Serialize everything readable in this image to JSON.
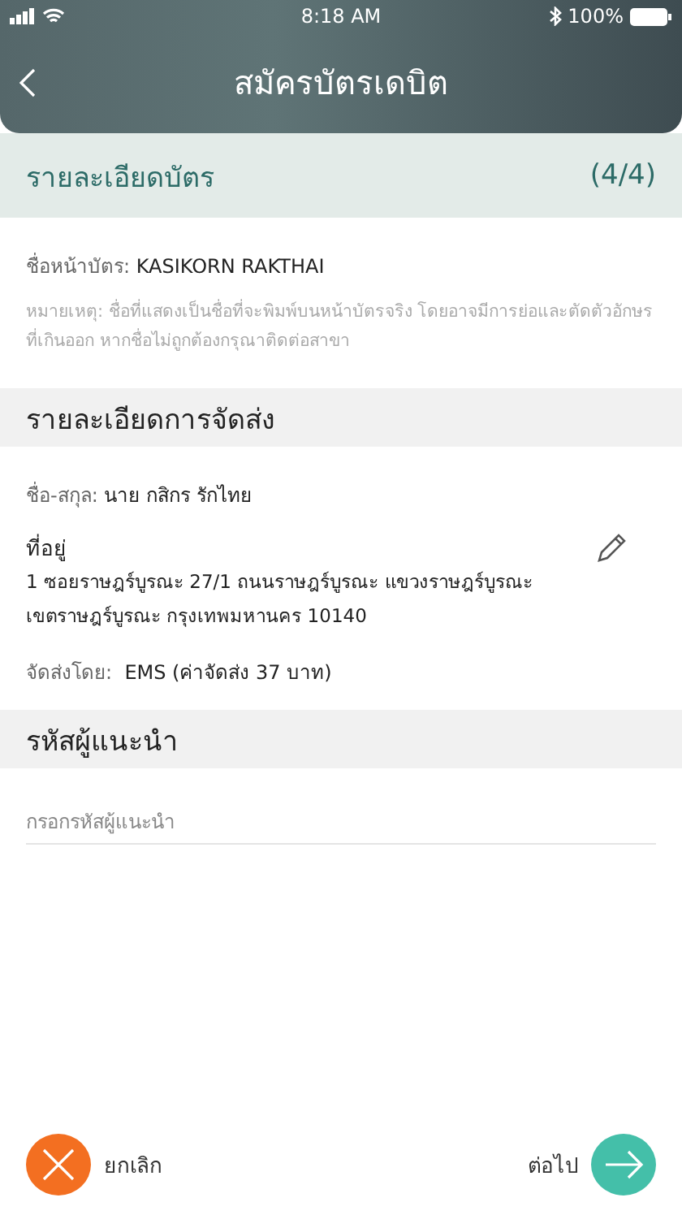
{
  "status_bar": {
    "time": "8:18 AM",
    "battery": "100%"
  },
  "header": {
    "title": "สมัครบัตรเดบิต"
  },
  "card_section": {
    "title": "รายละเอียดบัตร",
    "step": "(4/4)",
    "card_name_label": "ชื่อหน้าบัตร:",
    "card_name": "KASIKORN RAKTHAI",
    "note": "หมายเหตุ: ชื่อที่แสดงเป็นชื่อที่จะพิมพ์บนหน้าบัตรจริง โดยอาจมีการย่อและตัดตัวอักษรที่เกินออก หากชื่อไม่ถูกต้องกรุณาติดต่อสาขา"
  },
  "delivery": {
    "title": "รายละเอียดการจัดส่ง",
    "name_label": "ชื่อ-สกุล:",
    "name": "นาย กสิกร รักไทย",
    "address_label": "ที่อยู่",
    "address_lines": [
      "1 ซอยราษฎร์บูรณะ 27/1 ถนนราษฎร์บูรณะ แขวงราษฎร์บูรณะ",
      "เขตราษฎร์บูรณะ กรุงเทพมหานคร 10140"
    ],
    "shipping_label": "จัดส่งโดย:",
    "shipping": "EMS (ค่าจัดส่ง 37 บาท)"
  },
  "referral": {
    "title": "รหัสผู้แนะนำ",
    "placeholder": "กรอกรหัสผู้แนะนำ"
  },
  "footer": {
    "cancel": "ยกเลิก",
    "next": "ต่อไป"
  }
}
